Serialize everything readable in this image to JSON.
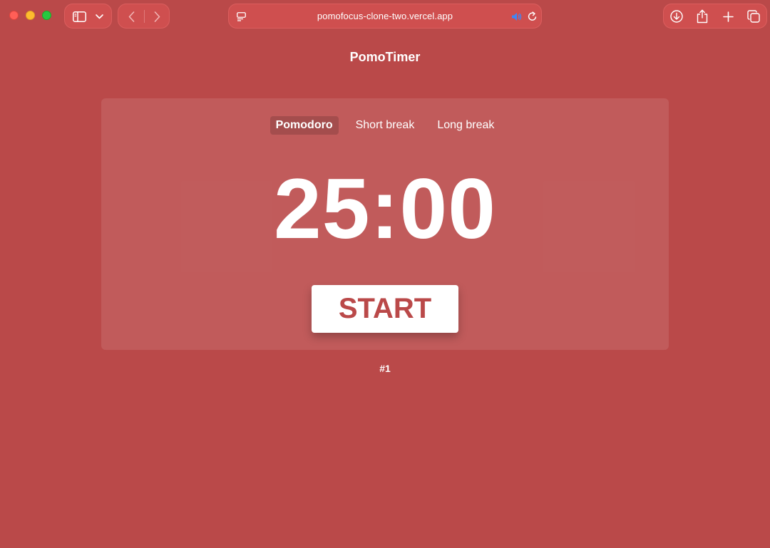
{
  "browser": {
    "url": "pomofocus-clone-two.vercel.app",
    "icons": {
      "sidebar": "sidebar-icon",
      "sidebar_menu": "chevron-down-icon",
      "back": "chevron-left-icon",
      "forward": "chevron-right-icon",
      "page_menu": "page-menu-icon",
      "audio": "speaker-icon",
      "reload": "reload-icon",
      "downloads": "download-icon",
      "share": "share-icon",
      "new_tab": "plus-icon",
      "tabs_overview": "tabs-overview-icon"
    }
  },
  "app": {
    "title": "PomoTimer",
    "tabs": [
      {
        "label": "Pomodoro",
        "active": true
      },
      {
        "label": "Short break",
        "active": false
      },
      {
        "label": "Long break",
        "active": false
      }
    ],
    "timer": "25:00",
    "start_label": "START",
    "session_counter": "#1"
  },
  "colors": {
    "background": "#ba4949",
    "card": "#c15c5c",
    "button_text": "#ba4949",
    "button_bg": "#ffffff"
  }
}
